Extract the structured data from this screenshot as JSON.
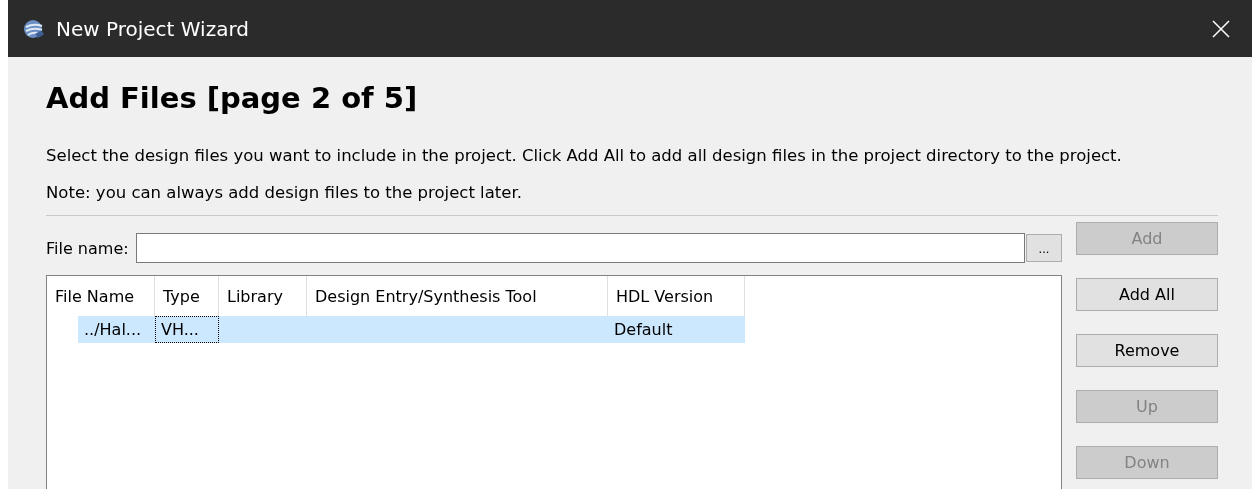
{
  "window": {
    "title": "New Project Wizard"
  },
  "page": {
    "heading": "Add Files [page 2 of 5]",
    "description": [
      "Select the design files you want to include in the project. Click Add All to add all design files in the project directory to the project.",
      "Note: you can always add design files to the project later."
    ]
  },
  "file_name": {
    "label": "File name:",
    "browse": "..."
  },
  "table": {
    "columns": [
      "File Name",
      "Type",
      "Library",
      "Design Entry/Synthesis Tool",
      "HDL Version"
    ],
    "rows": [
      {
        "selected": true,
        "cells": [
          {
            "text": "../Hal...",
            "focused": false
          },
          {
            "text": "VH...",
            "focused": true
          },
          null,
          null,
          {
            "text": "Default",
            "focused": false
          }
        ]
      }
    ]
  },
  "buttons": [
    {
      "label": "Add",
      "disabled": true
    },
    {
      "label": "Add All",
      "disabled": false
    },
    {
      "label": "Remove",
      "disabled": false
    },
    {
      "label": "Up",
      "disabled": true
    },
    {
      "label": "Down",
      "disabled": true
    }
  ]
}
